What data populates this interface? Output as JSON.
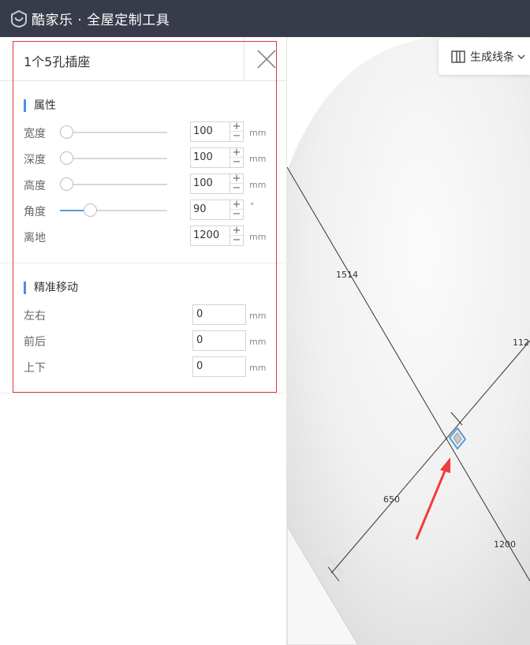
{
  "app": {
    "title": "酷家乐 · 全屋定制工具"
  },
  "panel": {
    "title": "1个5孔插座",
    "attributes": {
      "section_title": "属性",
      "rows": [
        {
          "label": "宽度",
          "value": "100",
          "unit": "mm",
          "slider_level": 0.0
        },
        {
          "label": "深度",
          "value": "100",
          "unit": "mm",
          "slider_level": 0.0
        },
        {
          "label": "高度",
          "value": "100",
          "unit": "mm",
          "slider_level": 0.0
        },
        {
          "label": "角度",
          "value": "90",
          "unit": "°",
          "slider_level": 0.25
        },
        {
          "label": "离地",
          "value": "1200",
          "unit": "mm"
        }
      ]
    },
    "move": {
      "section_title": "精准移动",
      "rows": [
        {
          "label": "左右",
          "value": "0",
          "unit": "mm"
        },
        {
          "label": "前后",
          "value": "0",
          "unit": "mm"
        },
        {
          "label": "上下",
          "value": "0",
          "unit": "mm"
        }
      ]
    }
  },
  "canvas": {
    "generate_lines_label": "生成线条",
    "dimensions": {
      "d1": "1514",
      "d2": "112",
      "d3": "650",
      "d4": "1200"
    }
  },
  "colors": {
    "topbar": "#373b4a",
    "accent": "#4a90e2",
    "highlight": "#d9363e",
    "arrow": "#f23b3b"
  },
  "icons": [
    "logo-icon",
    "close-icon",
    "generate-lines-icon",
    "chevron-down-icon",
    "plus-icon",
    "minus-icon"
  ]
}
